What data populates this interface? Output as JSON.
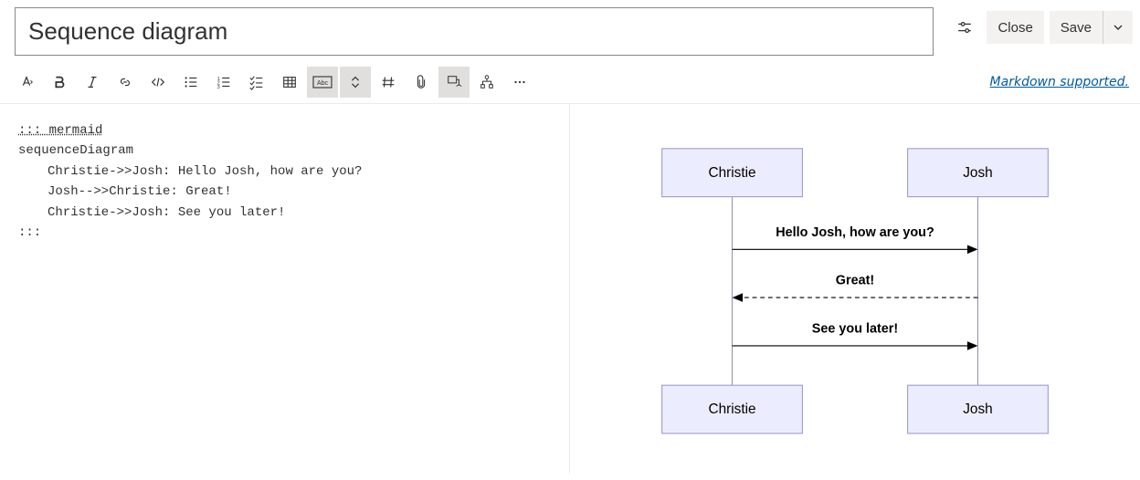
{
  "title": "Sequence diagram",
  "actions": {
    "close": "Close",
    "save": "Save"
  },
  "toolbar_link": "Markdown supported.",
  "editor": {
    "fence_open": "::: mermaid",
    "line1": "sequenceDiagram",
    "line2": "Christie->>Josh: Hello Josh, how are you?",
    "line3": "Josh-->>Christie: Great!",
    "line4": "Christie->>Josh: See you later!",
    "fence_close": ":::"
  },
  "diagram": {
    "actors": [
      "Christie",
      "Josh"
    ],
    "messages": [
      {
        "text": "Hello Josh, how are you?",
        "from": 0,
        "to": 1,
        "dashed": false
      },
      {
        "text": "Great!",
        "from": 1,
        "to": 0,
        "dashed": true
      },
      {
        "text": "See you later!",
        "from": 0,
        "to": 1,
        "dashed": false
      }
    ]
  }
}
